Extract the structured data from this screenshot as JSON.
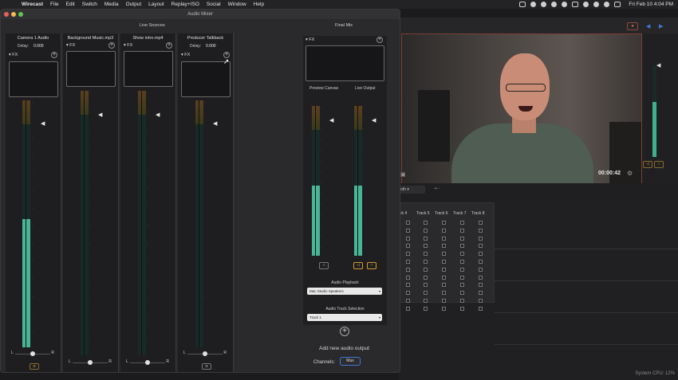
{
  "menubar": {
    "apple": "",
    "items": [
      "Wirecast",
      "File",
      "Edit",
      "Switch",
      "Media",
      "Output",
      "Layout",
      "Replay+ISO",
      "Social",
      "Window",
      "Help"
    ],
    "clock": "Fri Feb 10  4:04 PM"
  },
  "mixer": {
    "title": "Audio Mixer",
    "live_sources_label": "Live Sources",
    "final_mix_label": "Final Mix",
    "strips": [
      {
        "name": "Camera 1 Audio",
        "delay_label": "Delay:",
        "delay": "0.000",
        "fx": "FX",
        "level": 0.52
      },
      {
        "name": "Background Music.mp3",
        "fx": "FX",
        "level": 0.0
      },
      {
        "name": "Show intro.mp4",
        "fx": "FX",
        "level": 0.0
      },
      {
        "name": "Producer Talkback",
        "delay_label": "Delay:",
        "delay": "0.000",
        "fx": "FX",
        "level": 0.0
      }
    ],
    "pan_left": "L",
    "pan_right": "R",
    "final_mix": {
      "fx": "FX",
      "preview_label": "Preview Canvas",
      "live_label": "Live Output",
      "preview_level": 0.47,
      "live_level": 0.47,
      "audio_playback_label": "Audio Playback",
      "audio_playback_value": "Mac Studio Speakers",
      "track_selection_label": "Audio Track Selection",
      "track_selection_value": "Track 1"
    },
    "add_output_label": "Add new audio output",
    "channels_label": "Channels:",
    "channels_value": "Max"
  },
  "background": {
    "timecode": "00:00:42",
    "select_value": "oth",
    "tracks": [
      "ck 4",
      "Track 5",
      "Track 6",
      "Track 7",
      "Track 8"
    ],
    "system_cpu": "System CPU:  12%"
  }
}
